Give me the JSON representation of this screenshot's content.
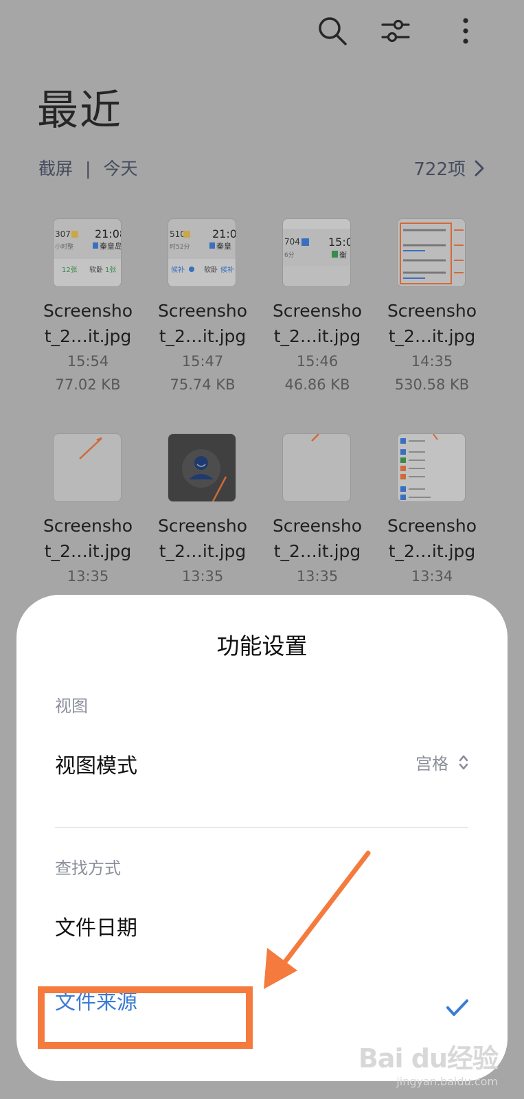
{
  "header": {
    "icons": [
      "search-icon",
      "filter-icon",
      "more-icon"
    ]
  },
  "page": {
    "title": "最近"
  },
  "section": {
    "label": "截屏",
    "separator": "|",
    "date": "今天",
    "count": "722项"
  },
  "files": [
    {
      "name1": "Screensho",
      "name2": "t_2…it.jpg",
      "time": "15:54",
      "size": "77.02 KB"
    },
    {
      "name1": "Screensho",
      "name2": "t_2…it.jpg",
      "time": "15:47",
      "size": "75.74 KB"
    },
    {
      "name1": "Screensho",
      "name2": "t_2…it.jpg",
      "time": "15:46",
      "size": "46.86 KB"
    },
    {
      "name1": "Screensho",
      "name2": "t_2…it.jpg",
      "time": "14:35",
      "size": "530.58 KB"
    },
    {
      "name1": "Screensho",
      "name2": "t_2…it.jpg",
      "time": "13:35"
    },
    {
      "name1": "Screensho",
      "name2": "t_2…it.jpg",
      "time": "13:35"
    },
    {
      "name1": "Screensho",
      "name2": "t_2…it.jpg",
      "time": "13:35"
    },
    {
      "name1": "Screensho",
      "name2": "t_2…it.jpg",
      "time": "13:34"
    }
  ],
  "thumbs": {
    "t1": {
      "a": "307",
      "b": "21:08",
      "c": "小时整",
      "d": "秦皇岛",
      "e": "12张",
      "f": "软卧",
      "g": "1张"
    },
    "t2": {
      "a": "510",
      "b": "21:0",
      "c": "时52分",
      "d": "秦皇",
      "e": "候补",
      "f": "软卧",
      "g": "候补"
    },
    "t3": {
      "a": "704",
      "b": "15:0",
      "c": "6分",
      "d": "衡"
    }
  },
  "sheet": {
    "title": "功能设置",
    "view_group": "视图",
    "view_mode_label": "视图模式",
    "view_mode_value": "宫格",
    "find_group": "查找方式",
    "option_date": "文件日期",
    "option_source": "文件来源"
  },
  "watermark": {
    "logo": "Bai du经验",
    "url": "jingyan.baidu.com"
  },
  "colors": {
    "accent": "#3a7bd5",
    "annotation": "#f47b3d",
    "overlay": "#a6a6a6"
  }
}
